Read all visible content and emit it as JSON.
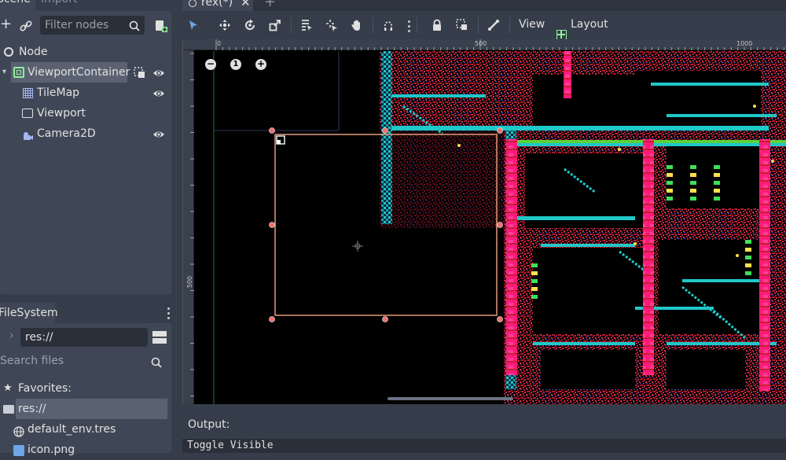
{
  "scene_dock": {
    "tabs": [
      "Scene",
      "Import"
    ],
    "filter_placeholder": "Filter nodes",
    "tree": [
      {
        "label": "Node",
        "icon": "node-icon"
      },
      {
        "label": "ViewportContainer",
        "icon": "viewport-container-icon",
        "selected": true
      },
      {
        "label": "TileMap",
        "icon": "tilemap-icon"
      },
      {
        "label": "Viewport",
        "icon": "viewport-icon"
      },
      {
        "label": "Camera2D",
        "icon": "camera2d-icon"
      }
    ]
  },
  "filesystem_dock": {
    "tab": "FileSystem",
    "path": "res://",
    "search_placeholder": "Search files",
    "items": [
      {
        "label": "Favorites:",
        "icon": "star-icon"
      },
      {
        "label": "res://",
        "icon": "folder-icon",
        "selected": true
      },
      {
        "label": "default_env.tres",
        "icon": "globe-icon"
      },
      {
        "label": "icon.png",
        "icon": "image-icon"
      }
    ]
  },
  "editor_tabs": [
    {
      "label": "rex(*)",
      "active": true
    }
  ],
  "toolbar": {
    "view_label": "View",
    "layout_label": "Layout"
  },
  "rulers": {
    "top": [
      "0",
      "500",
      "1000"
    ],
    "left": [
      "500"
    ]
  },
  "zoom": {
    "reset_label": "1"
  },
  "output": {
    "title": "Output:",
    "lines": [
      "Toggle Visible"
    ]
  },
  "colors": {
    "selection_rect": "#e39a7a",
    "handle": "#f07070",
    "accent": "#6fa7e6",
    "tile_red": "#c81e32",
    "tile_cyan": "#1fc8c8",
    "tile_magenta": "#ff1a7a"
  }
}
